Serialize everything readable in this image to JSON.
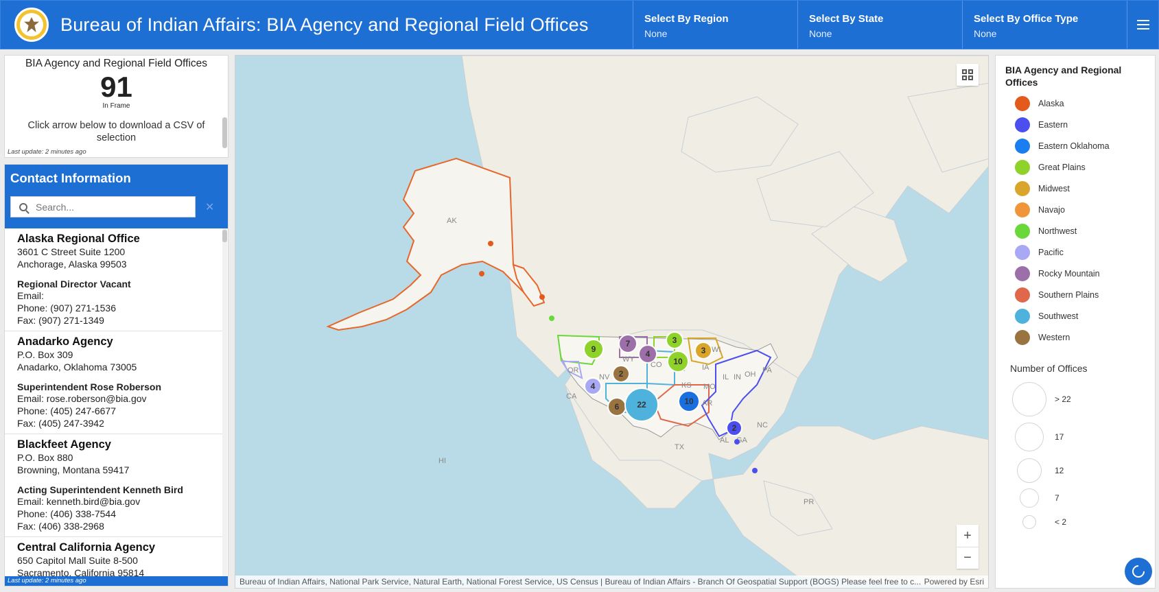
{
  "header": {
    "title": "Bureau of Indian Affairs: BIA Agency and Regional Field Offices",
    "selectors": [
      {
        "label": "Select By Region",
        "value": "None"
      },
      {
        "label": "Select By State",
        "value": "None"
      },
      {
        "label": "Select By Office Type",
        "value": "None"
      }
    ]
  },
  "stats": {
    "title": "BIA Agency and Regional Field Offices",
    "count": "91",
    "count_label": "In Frame",
    "description": "Click arrow below to download a CSV of selection",
    "last_update": "Last update: 2 minutes ago"
  },
  "contact": {
    "title": "Contact Information",
    "search_placeholder": "Search...",
    "last_update": "Last update: 2 minutes ago",
    "entries": [
      {
        "name": "Alaska Regional Office",
        "address1": "3601 C Street Suite 1200",
        "address2": "Anchorage, Alaska 99503",
        "role": "Regional Director Vacant",
        "email": "Email:",
        "phone": "Phone: (907) 271-1536",
        "fax": "Fax: (907) 271-1349"
      },
      {
        "name": "Anadarko Agency",
        "address1": "P.O. Box 309",
        "address2": "Anadarko, Oklahoma 73005",
        "role": "Superintendent Rose Roberson",
        "email": "Email: rose.roberson@bia.gov",
        "phone": "Phone: (405) 247-6677",
        "fax": "Fax: (405) 247-3942"
      },
      {
        "name": "Blackfeet Agency",
        "address1": "P.O. Box 880",
        "address2": "Browning, Montana 59417",
        "role": "Acting Superintendent Kenneth Bird",
        "email": "Email: kenneth.bird@bia.gov",
        "phone": "Phone: (406) 338-7544",
        "fax": "Fax: (406) 338-2968"
      },
      {
        "name": "Central California Agency",
        "address1": "650 Capitol Mall Suite 8-500",
        "address2": "Sacramento, California 95814",
        "role": "",
        "email": "",
        "phone": "",
        "fax": ""
      }
    ]
  },
  "map": {
    "labels": {
      "ak": "AK",
      "hi": "HI",
      "pr": "PR",
      "or": "OR",
      "id": "ID",
      "wy": "WY",
      "nv": "NV",
      "ut": "UT",
      "co": "CO",
      "ca": "CA",
      "ne": "NE",
      "ks": "KS",
      "mo": "MO",
      "ia": "IA",
      "wi": "WI",
      "il": "IL",
      "in": "IN",
      "oh": "OH",
      "pa": "PA",
      "ar": "AR",
      "tx": "TX",
      "al": "AL",
      "ga": "GA",
      "nc": "NC",
      "mt": "MT"
    },
    "clusters": [
      {
        "value": "9",
        "color": "#8fd32a"
      },
      {
        "value": "7",
        "color": "#9c6fa8"
      },
      {
        "value": "3",
        "color": "#8fd32a"
      },
      {
        "value": "4",
        "color": "#9c6fa8"
      },
      {
        "value": "10",
        "color": "#8fd32a"
      },
      {
        "value": "3",
        "color": "#d9a52a"
      },
      {
        "value": "2",
        "color": "#9a7440"
      },
      {
        "value": "4",
        "color": "#a8a8f5"
      },
      {
        "value": "6",
        "color": "#9a7440"
      },
      {
        "value": "22",
        "color": "#4fb2dc"
      },
      {
        "value": "10",
        "color": "#1a6fe0"
      },
      {
        "value": "2",
        "color": "#4b4ff0"
      }
    ],
    "attribution": "Bureau of Indian Affairs, National Park Service, Natural Earth, National Forest Service, US Census | Bureau of Indian Affairs - Branch Of Geospatial Support (BOGS) Please feel free to c...",
    "powered_by": "Powered by Esri",
    "zoom_in": "+",
    "zoom_out": "−"
  },
  "legend": {
    "title": "BIA Agency and Regional Offices",
    "items": [
      {
        "label": "Alaska",
        "color": "#e35a1c"
      },
      {
        "label": "Eastern",
        "color": "#4b4ff0"
      },
      {
        "label": "Eastern Oklahoma",
        "color": "#1a7ef0"
      },
      {
        "label": "Great Plains",
        "color": "#8fd32a"
      },
      {
        "label": "Midwest",
        "color": "#d9a52a"
      },
      {
        "label": "Navajo",
        "color": "#f0963a"
      },
      {
        "label": "Northwest",
        "color": "#6ad83a"
      },
      {
        "label": "Pacific",
        "color": "#a8a8f5"
      },
      {
        "label": "Rocky Mountain",
        "color": "#9c6fa8"
      },
      {
        "label": "Southern Plains",
        "color": "#e0674a"
      },
      {
        "label": "Southwest",
        "color": "#4fb2dc"
      },
      {
        "label": "Western",
        "color": "#9a7440"
      }
    ],
    "size_title": "Number of Offices",
    "sizes": [
      "> 22",
      "17",
      "12",
      "7",
      "< 2"
    ]
  }
}
